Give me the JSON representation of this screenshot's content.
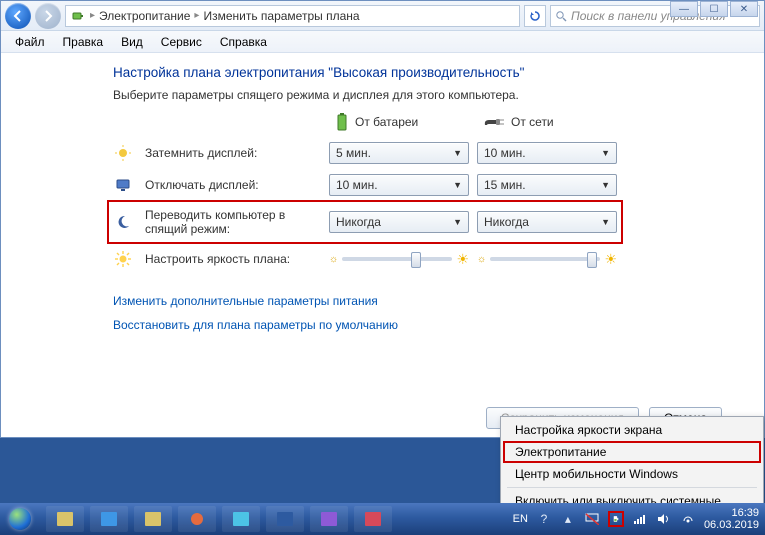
{
  "breadcrumb": {
    "root": "Электропитание",
    "leaf": "Изменить параметры плана"
  },
  "search": {
    "placeholder": "Поиск в панели управления"
  },
  "menubar": [
    "Файл",
    "Правка",
    "Вид",
    "Сервис",
    "Справка"
  ],
  "heading": "Настройка плана электропитания \"Высокая производительность\"",
  "instruction": "Выберите параметры спящего режима и дисплея для этого компьютера.",
  "cols": {
    "battery": "От батареи",
    "ac": "От сети"
  },
  "rows": {
    "dim": {
      "label": "Затемнить дисплей:",
      "battery": "5 мин.",
      "ac": "10 мин."
    },
    "off": {
      "label": "Отключать дисплей:",
      "battery": "10 мин.",
      "ac": "15 мин."
    },
    "sleep": {
      "label": "Переводить компьютер в спящий режим:",
      "battery": "Никогда",
      "ac": "Никогда"
    },
    "bright": {
      "label": "Настроить яркость плана:"
    }
  },
  "links": {
    "advanced": "Изменить дополнительные параметры питания",
    "restore": "Восстановить для плана параметры по умолчанию"
  },
  "buttons": {
    "save": "Сохранить изменения",
    "cancel": "Отмена"
  },
  "popup": {
    "brightness": "Настройка яркости экрана",
    "power": "Электропитание",
    "mobility": "Центр мобильности Windows",
    "toggle": "Включить или выключить системные значки"
  },
  "tray": {
    "lang": "EN",
    "time": "16:39",
    "date": "06.03.2019"
  }
}
